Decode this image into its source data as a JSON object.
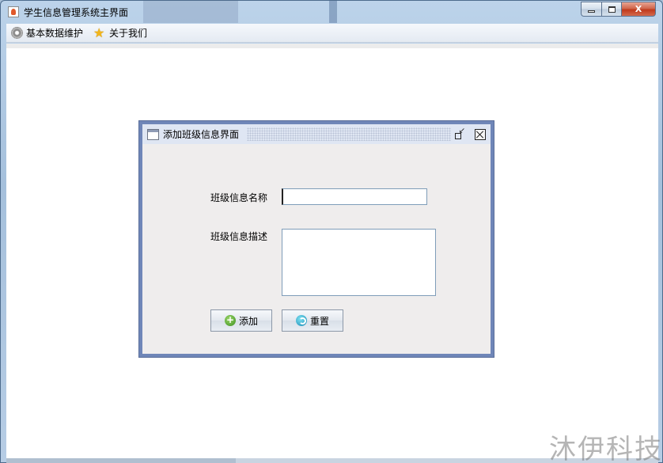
{
  "window": {
    "title": "学生信息管理系统主界面",
    "close_glyph": "X"
  },
  "menubar": {
    "items": [
      {
        "label": "基本数据维护",
        "icon": "gear-icon"
      },
      {
        "label": "关于我们",
        "icon": "star-icon"
      }
    ]
  },
  "internal_frame": {
    "title": "添加班级信息界面",
    "form": {
      "name_label": "班级信息名称",
      "name_value": "",
      "desc_label": "班级信息描述",
      "desc_value": ""
    },
    "buttons": {
      "add_label": "添加",
      "reset_label": "重置"
    }
  },
  "watermark": "沐伊科技"
}
